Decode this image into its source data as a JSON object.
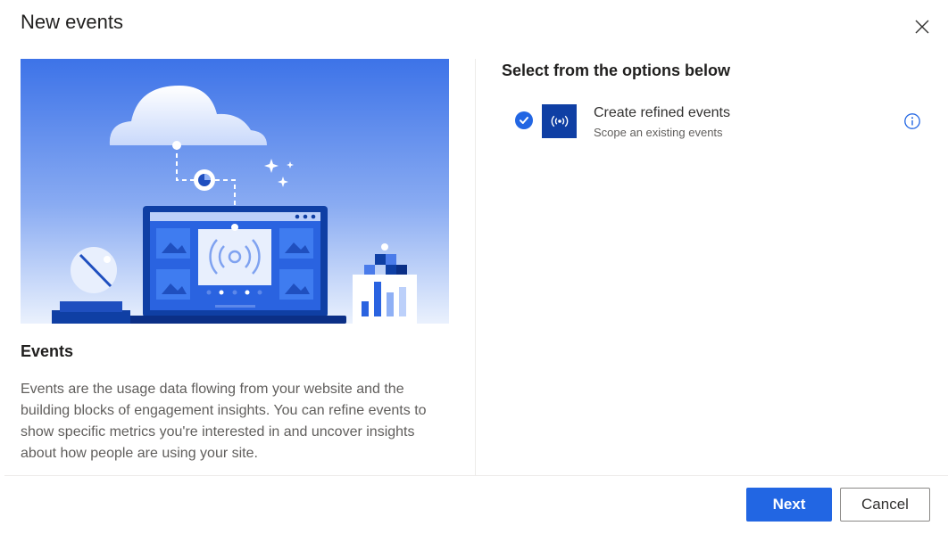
{
  "dialog": {
    "title": "New events",
    "close_icon": "close-icon"
  },
  "left": {
    "illustration": "events-illustration",
    "heading": "Events",
    "description": "Events are the usage data flowing from your website and the building blocks of engagement insights. You can refine events to show specific metrics you're interested in and uncover insights about how people are using your site."
  },
  "right": {
    "heading": "Select from the options below",
    "options": [
      {
        "title": "Create refined events",
        "subtitle": "Scope an existing events",
        "selected": true,
        "icon": "broadcast-icon",
        "info_icon": "info-icon"
      }
    ]
  },
  "footer": {
    "next_label": "Next",
    "cancel_label": "Cancel"
  },
  "colors": {
    "accent": "#2266e3",
    "icon_tile": "#0f3fa4",
    "hero_top": "#3d73e8",
    "hero_bottom": "#eaf1fd"
  }
}
